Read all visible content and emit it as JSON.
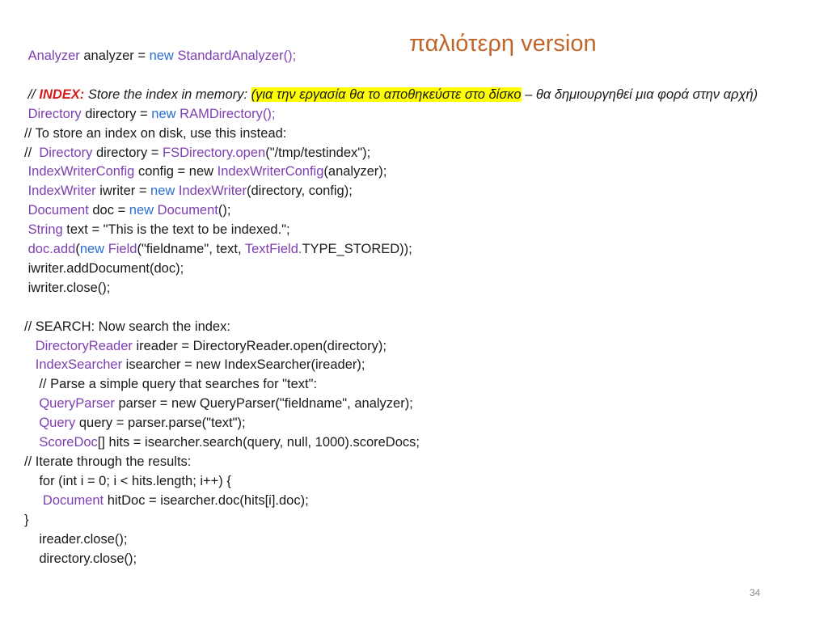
{
  "slide": {
    "title": "παλιότερη version",
    "page_number": "34"
  },
  "colors": {
    "class_name": "#7e3fb0",
    "keyword": "#2b6fd6",
    "index_label": "#d41c1c",
    "highlight": "#ffff00",
    "title": "#c0652a"
  },
  "code_lines": [
    [
      {
        "t": " "
      },
      {
        "t": "Analyzer",
        "c": "v"
      },
      {
        "t": " analyzer = "
      },
      {
        "t": "new",
        "c": "b"
      },
      {
        "t": " "
      },
      {
        "t": "StandardAnalyzer();",
        "c": "v"
      }
    ],
    [],
    [
      {
        "t": " // ",
        "c": "i"
      },
      {
        "t": "INDEX:",
        "c": "r"
      },
      {
        "t": " Store the index in memory: ",
        "c": "i"
      },
      {
        "t": "(για την εργασία θα το αποθηκεύστε στο δίσκο",
        "c": "h"
      },
      {
        "t": " – θα δημιουργηθεί μια φορά στην αρχή)",
        "c": "i"
      }
    ],
    [
      {
        "t": " "
      },
      {
        "t": "Directory",
        "c": "v"
      },
      {
        "t": " directory = "
      },
      {
        "t": "new",
        "c": "b"
      },
      {
        "t": " "
      },
      {
        "t": "RAMDirectory();",
        "c": "v"
      }
    ],
    [
      {
        "t": "// To store an index on disk, use this instead:"
      }
    ],
    [
      {
        "t": "//  "
      },
      {
        "t": "Directory",
        "c": "v"
      },
      {
        "t": " directory = "
      },
      {
        "t": "FSDirectory.open",
        "c": "v"
      },
      {
        "t": "(\"/tmp/testindex\");"
      }
    ],
    [
      {
        "t": " "
      },
      {
        "t": "IndexWriterConfig",
        "c": "v"
      },
      {
        "t": " config = new "
      },
      {
        "t": "IndexWriterConfig",
        "c": "v"
      },
      {
        "t": "(analyzer);"
      }
    ],
    [
      {
        "t": " "
      },
      {
        "t": "IndexWriter",
        "c": "v"
      },
      {
        "t": " iwriter = "
      },
      {
        "t": "new",
        "c": "b"
      },
      {
        "t": " "
      },
      {
        "t": "IndexWriter",
        "c": "v"
      },
      {
        "t": "(directory, config);"
      }
    ],
    [
      {
        "t": " "
      },
      {
        "t": "Document",
        "c": "v"
      },
      {
        "t": " doc = "
      },
      {
        "t": "new",
        "c": "b"
      },
      {
        "t": " "
      },
      {
        "t": "Document",
        "c": "v"
      },
      {
        "t": "();"
      }
    ],
    [
      {
        "t": " "
      },
      {
        "t": "String",
        "c": "v"
      },
      {
        "t": " text = \"This is the text to be indexed.\";"
      }
    ],
    [
      {
        "t": " "
      },
      {
        "t": "doc.add",
        "c": "v"
      },
      {
        "t": "("
      },
      {
        "t": "new",
        "c": "b"
      },
      {
        "t": " "
      },
      {
        "t": "Field",
        "c": "v"
      },
      {
        "t": "(\"fieldname\", text, "
      },
      {
        "t": "TextField.",
        "c": "v"
      },
      {
        "t": "TYPE_STORED));"
      }
    ],
    [
      {
        "t": " iwriter.addDocument(doc);"
      }
    ],
    [
      {
        "t": " iwriter.close();"
      }
    ],
    [],
    [
      {
        "t": "// SEARCH: Now search the index:"
      }
    ],
    [
      {
        "t": "   "
      },
      {
        "t": "DirectoryReader",
        "c": "v"
      },
      {
        "t": " ireader = DirectoryReader.open(directory);"
      }
    ],
    [
      {
        "t": "   "
      },
      {
        "t": "IndexSearcher",
        "c": "v"
      },
      {
        "t": " isearcher = new IndexSearcher(ireader);"
      }
    ],
    [
      {
        "t": "    // Parse a simple query that searches for \"text\":"
      }
    ],
    [
      {
        "t": "    "
      },
      {
        "t": "QueryParser",
        "c": "v"
      },
      {
        "t": " parser = new QueryParser(\"fieldname\", analyzer);"
      }
    ],
    [
      {
        "t": "    "
      },
      {
        "t": "Query",
        "c": "v"
      },
      {
        "t": " query = parser.parse(\"text\");"
      }
    ],
    [
      {
        "t": "    "
      },
      {
        "t": "ScoreDoc",
        "c": "v"
      },
      {
        "t": "[] hits = isearcher.search(query, null, 1000).scoreDocs;"
      }
    ],
    [
      {
        "t": "// Iterate through the results:"
      }
    ],
    [
      {
        "t": "    for (int i = 0; i < hits.length; i++) {"
      }
    ],
    [
      {
        "t": "     "
      },
      {
        "t": "Document",
        "c": "v"
      },
      {
        "t": " hitDoc = isearcher.doc(hits[i].doc);"
      }
    ],
    [
      {
        "t": "}"
      }
    ],
    [
      {
        "t": "    ireader.close();"
      }
    ],
    [
      {
        "t": "    directory.close();"
      }
    ]
  ]
}
